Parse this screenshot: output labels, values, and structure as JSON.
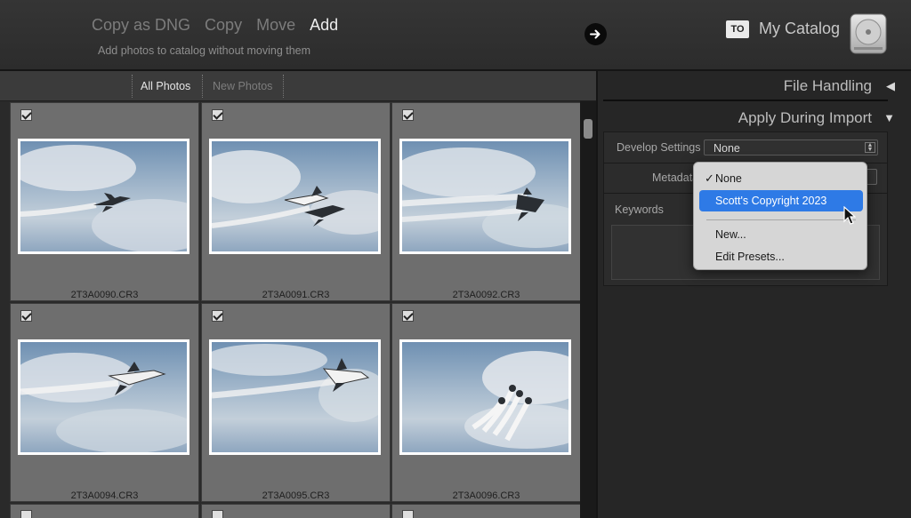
{
  "topbar": {
    "modes": [
      {
        "label": "Copy as DNG",
        "active": false
      },
      {
        "label": "Copy",
        "active": false
      },
      {
        "label": "Move",
        "active": false
      },
      {
        "label": "Add",
        "active": true
      }
    ],
    "mode_description": "Add photos to catalog without moving them",
    "to_badge": "TO",
    "catalog_name": "My Catalog"
  },
  "filterbar": {
    "all_photos": "All Photos",
    "new_photos": "New Photos"
  },
  "grid": {
    "files": [
      "2T3A0090.CR3",
      "2T3A0091.CR3",
      "2T3A0092.CR3",
      "2T3A0094.CR3",
      "2T3A0095.CR3",
      "2T3A0096.CR3"
    ]
  },
  "right_panel": {
    "file_handling": "File Handling",
    "apply_during_import": "Apply During Import",
    "develop_settings_label": "Develop Settings",
    "develop_settings_value": "None",
    "metadata_label": "Metadata",
    "keywords_label": "Keywords"
  },
  "popup": {
    "items": [
      {
        "label": "None",
        "checked": true
      },
      {
        "label": "Scott's Copyright 2023",
        "selected": true
      },
      {
        "label": "New..."
      },
      {
        "label": "Edit Presets..."
      }
    ]
  },
  "colors": {
    "accent_selection": "#2e7ae6",
    "cell_background": "#6e6e6e"
  }
}
